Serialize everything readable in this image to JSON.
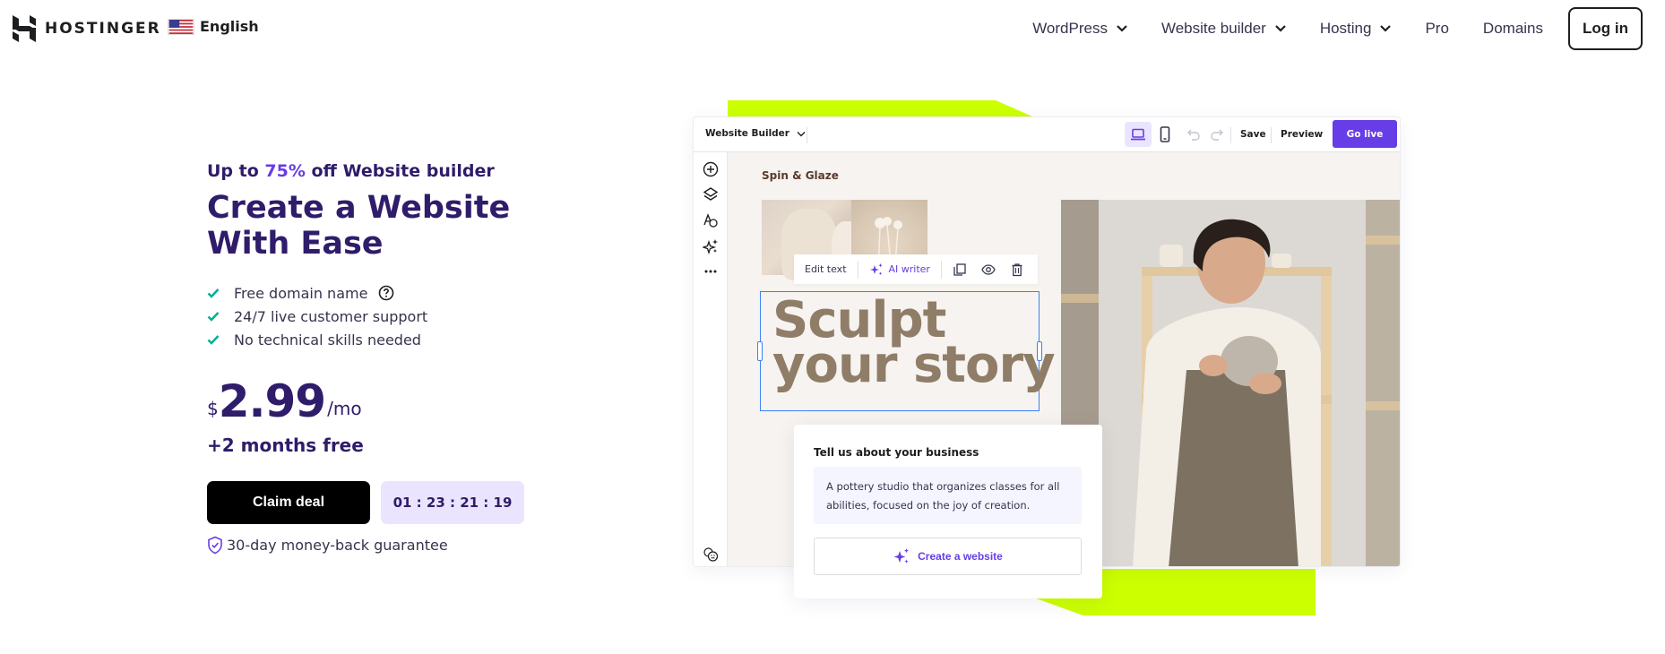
{
  "header": {
    "brand": "HOSTINGER",
    "language": "English",
    "nav": [
      {
        "label": "WordPress",
        "has_dropdown": true
      },
      {
        "label": "Website builder",
        "has_dropdown": true
      },
      {
        "label": "Hosting",
        "has_dropdown": true
      },
      {
        "label": "Pro",
        "has_dropdown": false
      },
      {
        "label": "Domains",
        "has_dropdown": false
      }
    ],
    "login_label": "Log in"
  },
  "hero": {
    "promo_prefix": "Up to ",
    "promo_accent": "75%",
    "promo_suffix": " off Website builder",
    "title": "Create a Website With Ease",
    "features": [
      {
        "label": "Free domain name",
        "has_help": true
      },
      {
        "label": "24/7 live customer support",
        "has_help": false
      },
      {
        "label": "No technical skills needed",
        "has_help": false
      }
    ],
    "price": {
      "currency": "$",
      "amount": "2.99",
      "period": "/mo"
    },
    "bonus": "+2 months free",
    "cta_label": "Claim deal",
    "timer": "01 : 23 : 21 : 19",
    "guarantee": "30-day money-back guarantee"
  },
  "builder": {
    "title": "Website Builder",
    "save_label": "Save",
    "preview_label": "Preview",
    "go_live_label": "Go live",
    "site_name": "Spin & Glaze",
    "float_bar": {
      "edit_text": "Edit text",
      "ai_writer": "AI writer"
    },
    "headline_line1": "Sculpt",
    "headline_line2": "your story",
    "card": {
      "title": "Tell us about your business",
      "input_value": "A pottery studio that organizes classes for all abilities, focused on the joy of creation.",
      "button_label": "Create a website"
    }
  },
  "colors": {
    "brand_purple": "#673de6",
    "text_dark": "#2f1c6a",
    "lime": "#ccff00",
    "check_green": "#00b090",
    "timer_bg": "#ebe4ff"
  }
}
